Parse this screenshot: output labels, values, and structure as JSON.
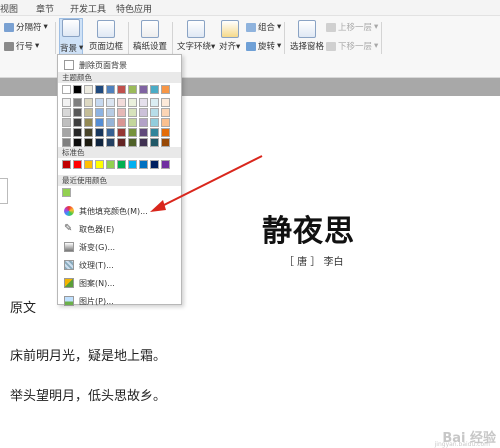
{
  "tabs": [
    "视图",
    "章节",
    "开发工具",
    "特色应用"
  ],
  "ribbon": {
    "page_numbers": "分隔符",
    "line_number": "行号",
    "background": "背景",
    "page_border": "页面边框",
    "manuscript": "稿纸设置",
    "text_wrap": "文字环绕",
    "align": "对齐",
    "group": "组合",
    "rotate": "旋转",
    "selection_pane": "选择窗格",
    "bring_forward": "上移一层",
    "send_backward": "下移一层"
  },
  "menu": {
    "delete_bg": "删除页面背景",
    "theme_colors": "主题颜色",
    "standard_colors": "标准色",
    "recent_colors": "最近使用颜色",
    "more_fill": "其他填充颜色(M)...",
    "eyedropper": "取色器(E)",
    "gradient": "渐变(G)...",
    "texture": "纹理(T)...",
    "pattern": "图案(N)...",
    "picture": "图片(P)..."
  },
  "theme_top": [
    "#ffffff",
    "#000000",
    "#eeece1",
    "#1f497d",
    "#4f81bd",
    "#c0504d",
    "#9bbb59",
    "#8064a2",
    "#4bacc6",
    "#f79646"
  ],
  "theme_shades": [
    [
      "#f2f2f2",
      "#7f7f7f",
      "#ddd9c3",
      "#c6d9f0",
      "#dbe5f1",
      "#f2dcdb",
      "#ebf1dd",
      "#e5e0ec",
      "#dbeef3",
      "#fdeada"
    ],
    [
      "#d8d8d8",
      "#595959",
      "#c4bd97",
      "#8db3e2",
      "#b8cce4",
      "#e5b9b7",
      "#d7e3bc",
      "#ccc1d9",
      "#b7dde8",
      "#fbd5b5"
    ],
    [
      "#bfbfbf",
      "#3f3f3f",
      "#938953",
      "#548dd4",
      "#95b3d7",
      "#d99694",
      "#c3d69b",
      "#b2a2c7",
      "#92cddc",
      "#fac08f"
    ],
    [
      "#a5a5a5",
      "#262626",
      "#494429",
      "#17365d",
      "#366092",
      "#953734",
      "#76923c",
      "#5f497a",
      "#31859b",
      "#e36c09"
    ],
    [
      "#7f7f7f",
      "#0c0c0c",
      "#1d1b10",
      "#0f243e",
      "#244061",
      "#632423",
      "#4f6128",
      "#3f3151",
      "#205867",
      "#974806"
    ]
  ],
  "standard": [
    "#c00000",
    "#ff0000",
    "#ffc000",
    "#ffff00",
    "#92d050",
    "#00b050",
    "#00b0f0",
    "#0070c0",
    "#002060",
    "#7030a0"
  ],
  "recent": [
    "#92d050"
  ],
  "document": {
    "title": "静夜思",
    "author": "［ 唐 ］ 李白",
    "heading": "原文",
    "line1": "床前明月光，疑是地上霜。",
    "line2": "举头望明月，低头思故乡。"
  },
  "watermark": "Bai 经验",
  "watermark_url": "jingyan.baidu.com",
  "accent": "#d9261c"
}
